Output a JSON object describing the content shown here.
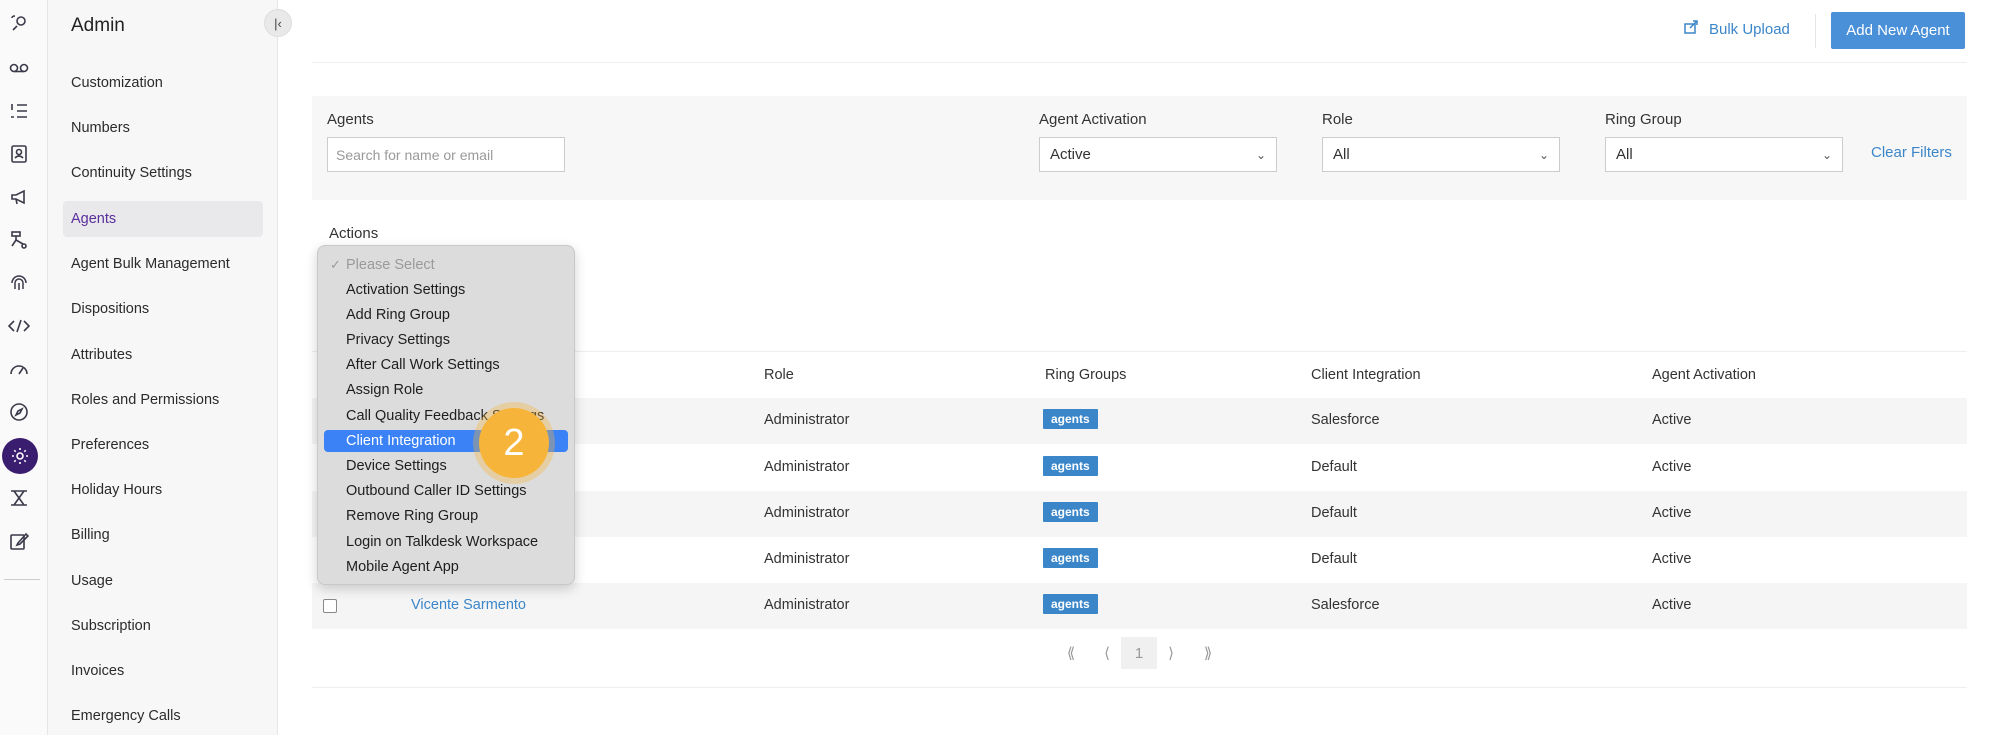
{
  "rail": {
    "icons": [
      "phone-flow-icon",
      "voicemail-icon",
      "list-numbered-icon",
      "contacts-icon",
      "megaphone-icon",
      "workflow-icon",
      "fingerprint-icon",
      "code-icon",
      "speedometer-icon",
      "compass-icon",
      "gear-icon",
      "routing-icon",
      "edit-note-icon"
    ],
    "active_index": 10,
    "accent": "#3a1d6e"
  },
  "sidebar": {
    "title": "Admin",
    "items": [
      {
        "label": "Customization"
      },
      {
        "label": "Numbers"
      },
      {
        "label": "Continuity Settings"
      },
      {
        "label": "Agents",
        "active": true
      },
      {
        "label": "Agent Bulk Management"
      },
      {
        "label": "Dispositions"
      },
      {
        "label": "Attributes"
      },
      {
        "label": "Roles and Permissions"
      },
      {
        "label": "Preferences"
      },
      {
        "label": "Holiday Hours"
      },
      {
        "label": "Billing"
      },
      {
        "label": "Usage"
      },
      {
        "label": "Subscription"
      },
      {
        "label": "Invoices"
      },
      {
        "label": "Emergency Calls"
      }
    ]
  },
  "header": {
    "bulk_upload": "Bulk Upload",
    "add_new_agent": "Add New Agent"
  },
  "filters": {
    "agents_label": "Agents",
    "search_placeholder": "Search for name or email",
    "activation_label": "Agent Activation",
    "activation_value": "Active",
    "role_label": "Role",
    "role_value": "All",
    "ring_group_label": "Ring Group",
    "ring_group_value": "All",
    "clear_filters": "Clear Filters"
  },
  "actions": {
    "label": "Actions",
    "options": [
      {
        "label": "Please Select",
        "disabled": true,
        "checked": true
      },
      {
        "label": "Activation Settings"
      },
      {
        "label": "Add Ring Group"
      },
      {
        "label": "Privacy Settings"
      },
      {
        "label": "After Call Work Settings"
      },
      {
        "label": "Assign Role"
      },
      {
        "label": "Call Quality Feedback Settings"
      },
      {
        "label": "Client Integration",
        "highlighted": true
      },
      {
        "label": "Device Settings"
      },
      {
        "label": "Outbound Caller ID Settings"
      },
      {
        "label": "Remove Ring Group"
      },
      {
        "label": "Login on Talkdesk Workspace"
      },
      {
        "label": "Mobile Agent App"
      }
    ]
  },
  "step_badge": "2",
  "table": {
    "headers": {
      "role": "Role",
      "ring_groups": "Ring Groups",
      "client_integration": "Client Integration",
      "agent_activation": "Agent Activation"
    },
    "rows": [
      {
        "name": "",
        "role": "Administrator",
        "ring_group": "agents",
        "client_integration": "Salesforce",
        "activation": "Active"
      },
      {
        "name": "",
        "role": "Administrator",
        "ring_group": "agents",
        "client_integration": "Default",
        "activation": "Active"
      },
      {
        "name": "",
        "role": "Administrator",
        "ring_group": "agents",
        "client_integration": "Default",
        "activation": "Active"
      },
      {
        "name": "",
        "role": "Administrator",
        "ring_group": "agents",
        "client_integration": "Default",
        "activation": "Active"
      },
      {
        "name": "Vicente Sarmento",
        "role": "Administrator",
        "ring_group": "agents",
        "client_integration": "Salesforce",
        "activation": "Active"
      }
    ]
  },
  "pagination": {
    "first": "⟪",
    "prev": "⟨",
    "page": "1",
    "next": "⟩",
    "last": "⟫"
  }
}
